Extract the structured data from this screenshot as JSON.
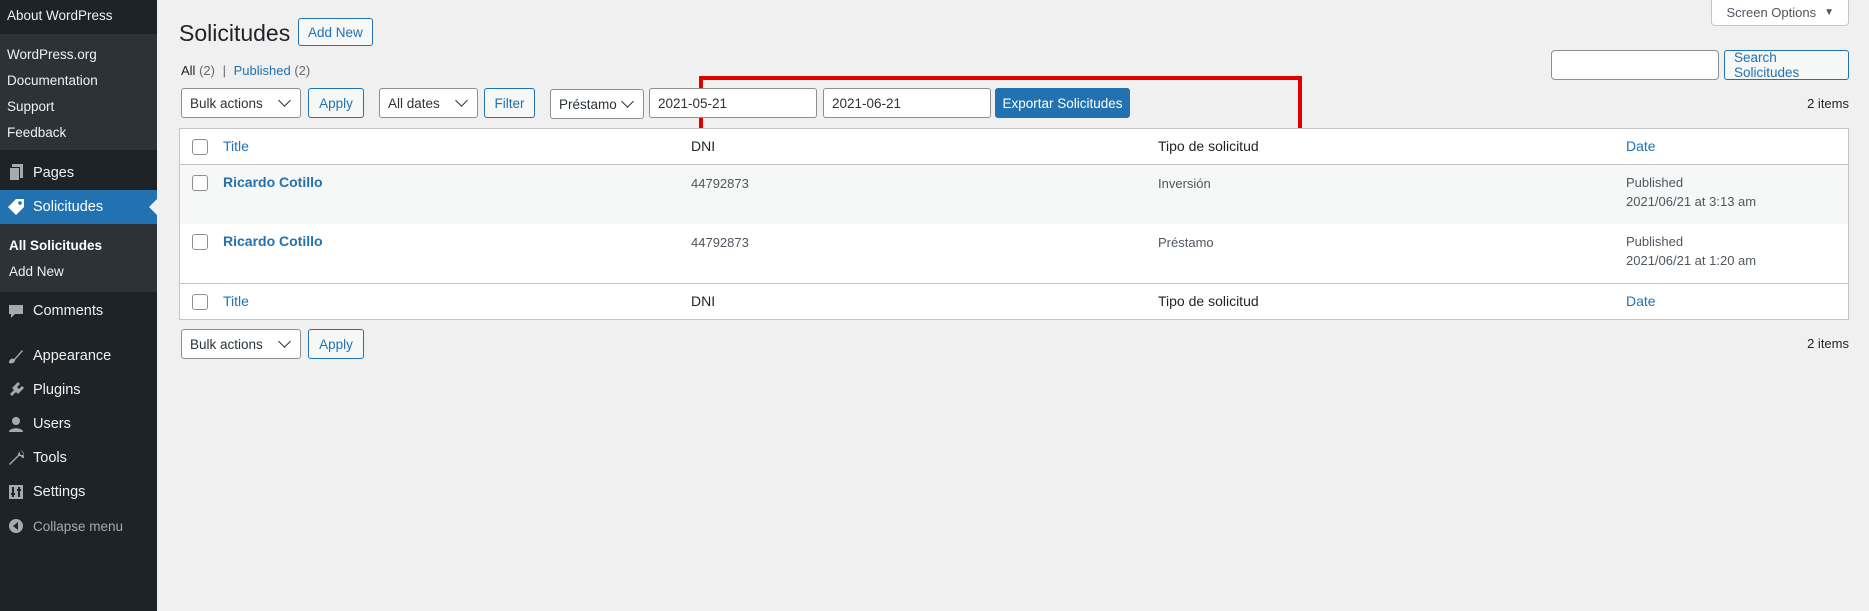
{
  "sidebar": {
    "about": "About WordPress",
    "links": [
      "WordPress.org",
      "Documentation",
      "Support",
      "Feedback"
    ],
    "pages": "Pages",
    "solicitudes": "Solicitudes",
    "sub": [
      "All Solicitudes",
      "Add New"
    ],
    "comments": "Comments",
    "appearance": "Appearance",
    "plugins": "Plugins",
    "users": "Users",
    "tools": "Tools",
    "settings": "Settings",
    "collapse": "Collapse menu"
  },
  "header": {
    "title": "Solicitudes",
    "add_new": "Add New",
    "screen_options": "Screen Options"
  },
  "views": {
    "all": "All",
    "all_count": "(2)",
    "sep": "|",
    "published": "Published",
    "published_count": "(2)"
  },
  "search": {
    "button": "Search Solicitudes"
  },
  "toolbar_top": {
    "bulk_actions": "Bulk actions",
    "apply": "Apply",
    "all_dates": "All dates",
    "filter": "Filter",
    "tipo_select": "Préstamo",
    "date_from": "2021-05-21",
    "date_to": "2021-06-21",
    "export": "Exportar Solicitudes",
    "count": "2 items"
  },
  "table": {
    "columns": {
      "title": "Title",
      "dni": "DNI",
      "tipo": "Tipo de solicitud",
      "date": "Date"
    },
    "rows": [
      {
        "title": "Ricardo Cotillo",
        "dni": "44792873",
        "tipo": "Inversión",
        "status": "Published",
        "date": "2021/06/21 at 3:13 am"
      },
      {
        "title": "Ricardo Cotillo",
        "dni": "44792873",
        "tipo": "Préstamo",
        "status": "Published",
        "date": "2021/06/21 at 1:20 am"
      }
    ]
  },
  "toolbar_bottom": {
    "bulk_actions": "Bulk actions",
    "apply": "Apply",
    "count": "2 items"
  },
  "colors": {
    "sidebar_bg": "#1d2327",
    "accent": "#2271b1",
    "highlight_box": "#e00000"
  }
}
